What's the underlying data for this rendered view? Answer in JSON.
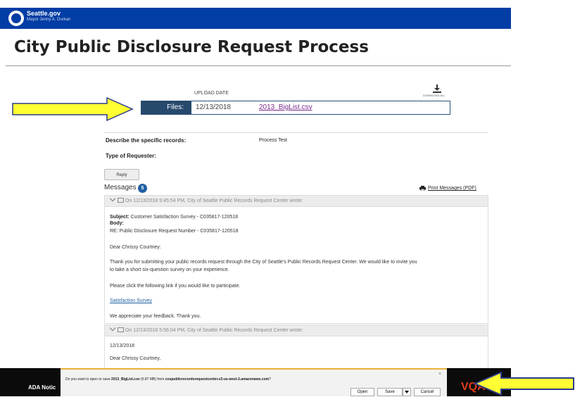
{
  "header": {
    "brand": "Seattle.gov",
    "mayor": "Mayor Jenny A. Durkan"
  },
  "page_title": "City Public Disclosure Request Process",
  "files": {
    "upload_date_label": "UPLOAD DATE",
    "download_all_label": "DOWNLOAD ALL",
    "label": "Files:",
    "date": "12/13/2018",
    "filename": "2013_BigList.csv"
  },
  "details": {
    "records_label": "Describe the specific records:",
    "records_value": "Process Test",
    "requester_label": "Type of Requester:"
  },
  "reply_label": "Reply",
  "messages": {
    "label": "Messages",
    "count": "5",
    "print_label": "Print Messages (PDF)",
    "message1": {
      "header": "On 12/13/2018 9:45:54 PM, City of Seattle Public Records Request Center wrote:",
      "subject_label": "Subject:",
      "subject": "Customer Satisfaction Survey - C035817-120518",
      "body_label": "Body:",
      "re_line": "RE: Public Disclosure Request Number - C035817-120518",
      "greeting": "Dear Chrissy Courtney:",
      "para1_line1": "Thank you for submitting your public records request through the City of Seattle's Public Records Request Center. We would like to invite you",
      "para1_line2": "to take a short six-question survey on your experience.",
      "para2": "Please click the following link if you would like to participate.",
      "survey_link": "Satisfaction Survey",
      "closing": "We appreciate your feedback. Thank you."
    },
    "message2": {
      "header": "On 12/13/2018 5:56:04 PM, City of Seattle Public Records Request Center wrote:",
      "date": "12/13/2018",
      "greeting": "Dear Chrissy Courtney,"
    }
  },
  "footer": {
    "ada": "ADA Notic"
  },
  "download_bar": {
    "msg_pre": "Do you want to open or save ",
    "file": "2013_BigList.csv",
    "msg_mid": " (6.87 MB) from ",
    "host": "cospublicrecordsrequestcenter.s3-us-west-2.amazonaws.com",
    "msg_end": "?",
    "open": "Open",
    "save": "Save",
    "cancel": "Cancel",
    "close": "×"
  },
  "colors": {
    "header_bg": "#003da5",
    "files_label_bg": "#27496d",
    "arrow": "#ffff33",
    "badge": "#1f5fa3"
  }
}
